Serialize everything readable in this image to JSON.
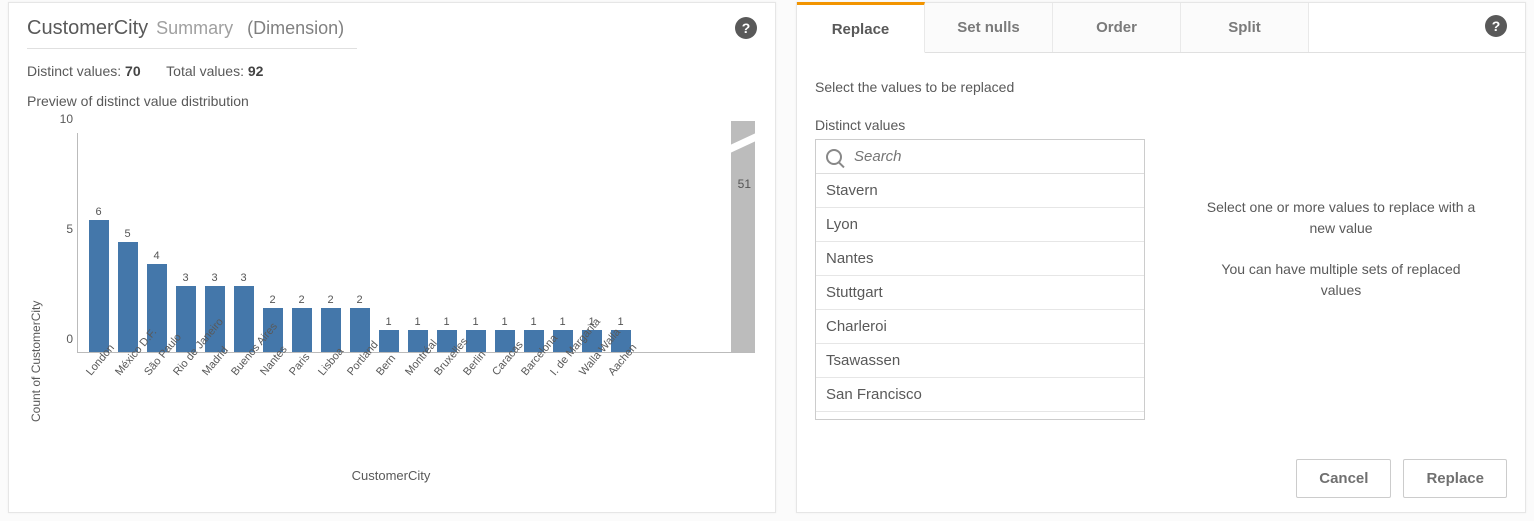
{
  "left": {
    "title": "CustomerCity",
    "subtitle": "Summary",
    "paren": "(Dimension)",
    "distinct_label": "Distinct values:",
    "distinct_value": "70",
    "total_label": "Total values:",
    "total_value": "92",
    "preview_label": "Preview of distinct value distribution",
    "xlabel": "CustomerCity"
  },
  "chart_data": {
    "type": "bar",
    "title": "Preview of distinct value distribution",
    "xlabel": "CustomerCity",
    "ylabel": "Count of CustomerCity",
    "ylim": [
      0,
      10
    ],
    "yticks": [
      0,
      5,
      10
    ],
    "categories": [
      "London",
      "México D.F.",
      "São Paulo",
      "Rio de Janeiro",
      "Madrid",
      "Buenos Aires",
      "Nantes",
      "Paris",
      "Lisboa",
      "Portland",
      "Bern",
      "Montréal",
      "Bruxelles",
      "Berlin",
      "Caracas",
      "Barcelona",
      "I. de Margarita",
      "Walla Walla",
      "Aachen"
    ],
    "values": [
      6,
      5,
      4,
      3,
      3,
      3,
      2,
      2,
      2,
      2,
      1,
      1,
      1,
      1,
      1,
      1,
      1,
      1,
      1
    ],
    "overflow_remaining_sum": 51
  },
  "right": {
    "tabs": [
      "Replace",
      "Set nulls",
      "Order",
      "Split"
    ],
    "active_tab": 0,
    "instruction": "Select the values to be replaced",
    "dv_label": "Distinct values",
    "search_placeholder": "Search",
    "dv_items": [
      "Stavern",
      "Lyon",
      "Nantes",
      "Stuttgart",
      "Charleroi",
      "Tsawassen",
      "San Francisco"
    ],
    "hint1": "Select one or more values to replace with a new value",
    "hint2": "You can have multiple sets of replaced values",
    "btn_cancel": "Cancel",
    "btn_replace": "Replace"
  }
}
